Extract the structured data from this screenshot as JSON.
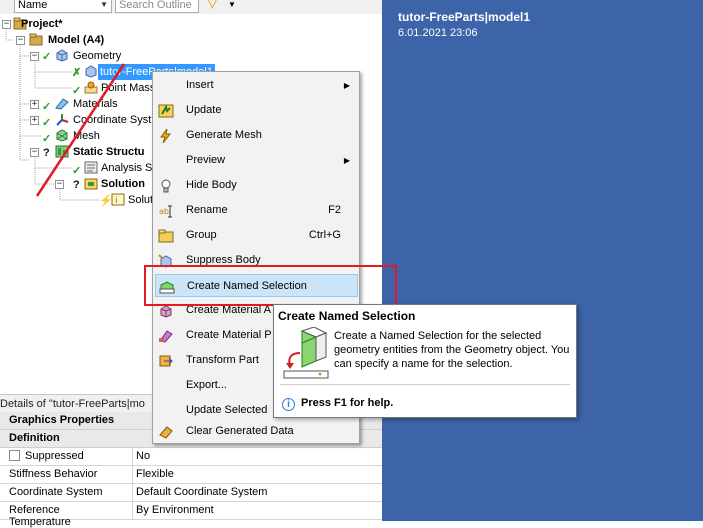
{
  "toolbar": {
    "name_select": "Name",
    "search_placeholder": "Search Outline"
  },
  "tree": {
    "project": "Project*",
    "model": "Model (A4)",
    "geometry": "Geometry",
    "part": "tutor-FreeParts|model1",
    "point_mass": "Point Mass",
    "materials": "Materials",
    "coordinate_systems": "Coordinate Syst",
    "mesh": "Mesh",
    "static_structural": "Static Structu",
    "analysis_settings": "Analysis Se",
    "solution": "Solution",
    "solution_information": "Solut"
  },
  "graphics": {
    "title": "tutor-FreeParts|model1",
    "date": "6.01.2021 23:06",
    "background": "#3d64a8"
  },
  "context_menu": {
    "items": [
      {
        "label": "Insert",
        "shortcut": "",
        "submenu": true,
        "icon": "none"
      },
      {
        "label": "Update",
        "shortcut": "",
        "submenu": false,
        "icon": "update-icon"
      },
      {
        "label": "Generate Mesh",
        "shortcut": "",
        "submenu": false,
        "icon": "lightning-icon"
      },
      {
        "label": "Preview",
        "shortcut": "",
        "submenu": true,
        "icon": "none"
      },
      {
        "label": "Hide Body",
        "shortcut": "",
        "submenu": false,
        "icon": "lightbulb-icon"
      },
      {
        "label": "Rename",
        "shortcut": "F2",
        "submenu": false,
        "icon": "rename-icon"
      },
      {
        "label": "Group",
        "shortcut": "Ctrl+G",
        "submenu": false,
        "icon": "folder-icon"
      },
      {
        "label": "Suppress Body",
        "shortcut": "",
        "submenu": false,
        "icon": "suppress-icon"
      },
      {
        "label": "Create Named Selection",
        "shortcut": "",
        "submenu": false,
        "icon": "named-selection-icon"
      },
      {
        "label": "Create Material A",
        "shortcut": "",
        "submenu": false,
        "icon": "material-icon"
      },
      {
        "label": "Create Material P",
        "shortcut": "",
        "submenu": false,
        "icon": "material-plot-icon"
      },
      {
        "label": "Transform Part",
        "shortcut": "",
        "submenu": false,
        "icon": "transform-icon"
      },
      {
        "label": "Export...",
        "shortcut": "",
        "submenu": false,
        "icon": "none"
      },
      {
        "label": "Update Selected",
        "shortcut": "",
        "submenu": false,
        "icon": "none"
      },
      {
        "label": "Clear Generated Data",
        "shortcut": "",
        "submenu": false,
        "icon": "eraser-icon"
      }
    ],
    "highlight_color": "#e01b24"
  },
  "tooltip": {
    "title": "Create Named Selection",
    "description": "Create a Named Selection for the selected geometry entities from the Geometry object. You can specify a name for the selection.",
    "help": "Press F1 for help."
  },
  "details": {
    "header": "Details of \"tutor-FreeParts|mo",
    "groups": [
      {
        "title": "Graphics Properties"
      },
      {
        "title": "Definition"
      }
    ],
    "rows": [
      {
        "key": "Suppressed",
        "value": "No"
      },
      {
        "key": "Stiffness Behavior",
        "value": "Flexible"
      },
      {
        "key": "Coordinate System",
        "value": "Default Coordinate System"
      },
      {
        "key": "Reference Temperature",
        "value": "By Environment"
      }
    ]
  }
}
